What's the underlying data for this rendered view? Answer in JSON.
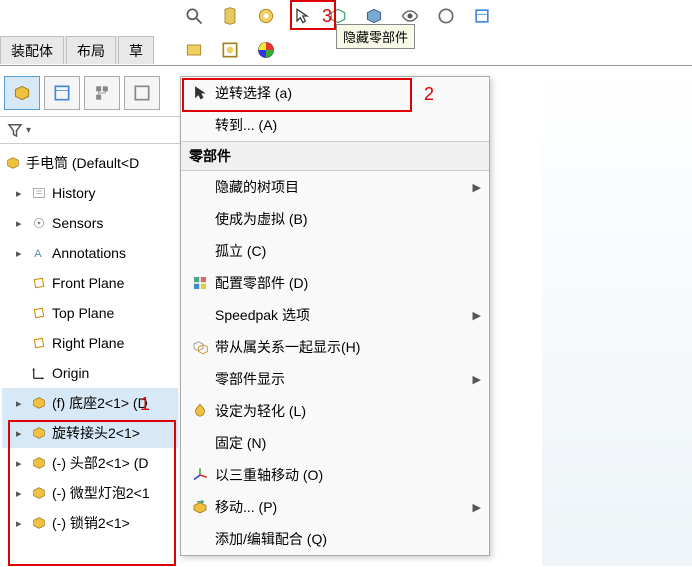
{
  "top_tabs": {
    "assembly": "装配体",
    "layout": "布局",
    "sketch": "草"
  },
  "tooltip": "隐藏零部件",
  "annotations": {
    "one": "1",
    "two": "2",
    "three": "3"
  },
  "tree": {
    "root": "手电筒  (Default<D",
    "history": "History",
    "sensors": "Sensors",
    "annotations": "Annotations",
    "front_plane": "Front Plane",
    "top_plane": "Top Plane",
    "right_plane": "Right Plane",
    "origin": "Origin",
    "part1": "(f) 底座2<1>  (D",
    "part2": "旋转接头2<1>",
    "part3": "(-) 头部2<1> (D",
    "part4": "(-) 微型灯泡2<1",
    "part5": "(-) 锁销2<1>"
  },
  "menu": {
    "invert_selection": "逆转选择 (a)",
    "go_to": "转到... (A)",
    "header_components": "零部件",
    "hidden_tree_items": "隐藏的树项目",
    "make_virtual": "使成为虚拟 (B)",
    "isolate": "孤立 (C)",
    "configure_component": "配置零部件 (D)",
    "speedpak": "Speedpak 选项",
    "show_with_dependents": "带从属关系一起显示(H)",
    "component_display": "零部件显示",
    "set_lightweight": "设定为轻化 (L)",
    "fix": "固定 (N)",
    "move_with_triad": "以三重轴移动 (O)",
    "move": "移动... (P)",
    "add_edit_mates": "添加/编辑配合 (Q)"
  }
}
